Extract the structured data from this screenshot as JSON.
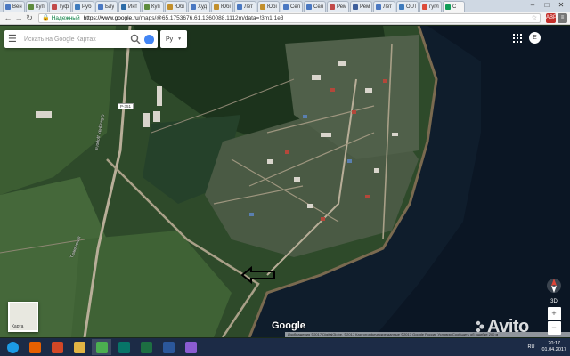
{
  "browser": {
    "tabs": [
      {
        "label": "Вен",
        "color": "#4a78c2"
      },
      {
        "label": "Куп",
        "color": "#5d8b3e"
      },
      {
        "label": "Туф",
        "color": "#c24a4a"
      },
      {
        "label": "Руб",
        "color": "#3e7bbd"
      },
      {
        "label": "Блу",
        "color": "#4a78c2"
      },
      {
        "label": "Инт",
        "color": "#2c6ca8"
      },
      {
        "label": "Куп",
        "color": "#5d8b3e"
      },
      {
        "label": "Юбі",
        "color": "#c28f2c"
      },
      {
        "label": "Худ",
        "color": "#4a78c2"
      },
      {
        "label": "Юбі",
        "color": "#c28f2c"
      },
      {
        "label": "Лет",
        "color": "#4a78c2"
      },
      {
        "label": "Юбі",
        "color": "#c28f2c"
      },
      {
        "label": "Сел",
        "color": "#4a78c2"
      },
      {
        "label": "Сел",
        "color": "#4a78c2"
      },
      {
        "label": "Рем",
        "color": "#c24a4a"
      },
      {
        "label": "Рем",
        "color": "#3e5f9c"
      },
      {
        "label": "Лет",
        "color": "#4a78c2"
      },
      {
        "label": "OUT",
        "color": "#3e7bbd"
      },
      {
        "label": "гугл",
        "color": "#dd4b39"
      },
      {
        "label": "С",
        "color": "#0f9d58",
        "active": true
      }
    ],
    "window_controls": [
      "–",
      "□",
      "✕"
    ],
    "secure_label": "Надежный",
    "url_host": "https://www.google.ru",
    "url_path": "/maps/@65.1753676,61.1360088,1112m/data=!3m1!1e3",
    "extensions": [
      {
        "label": "ABP",
        "color": "#c4302b"
      },
      {
        "label": "≡",
        "color": "#777777"
      }
    ]
  },
  "map": {
    "search_placeholder": "Искать на Google Картах",
    "language": "Ру",
    "avatar_letter": "E",
    "road_label": "Р-351",
    "streets": [
      {
        "text": "Обходная дорога"
      },
      {
        "text": "Тюменская"
      }
    ],
    "view_3d": "3D",
    "zoom_in": "+",
    "zoom_out": "−",
    "thumb_label": "Карта",
    "google_logo": "Google",
    "attribution": "Изображения ©2017 DigitalGlobe, ©2017 Картографические данные ©2017 Google   Россия   Условия   Сообщить об ошибке   200 м",
    "watermark": "Avito",
    "colors": {
      "water": "#0f1d2c",
      "forest": "#1f3a1f",
      "field": "#3c5d32",
      "accent_blue": "#4285f4"
    }
  },
  "taskbar": {
    "apps": [
      {
        "name": "start",
        "color": "#1c9be6"
      },
      {
        "name": "firefox",
        "color": "#e66000"
      },
      {
        "name": "powerpoint",
        "color": "#d24726"
      },
      {
        "name": "explorer",
        "color": "#e2b544"
      },
      {
        "name": "chrome",
        "color": "#4caf50",
        "active": true
      },
      {
        "name": "publisher",
        "color": "#077568"
      },
      {
        "name": "excel",
        "color": "#1d6f42"
      },
      {
        "name": "word",
        "color": "#2b579a"
      },
      {
        "name": "paint",
        "color": "#8a5cd1"
      }
    ],
    "language": "RU",
    "time": "20:17",
    "date": "01.04.2017"
  }
}
